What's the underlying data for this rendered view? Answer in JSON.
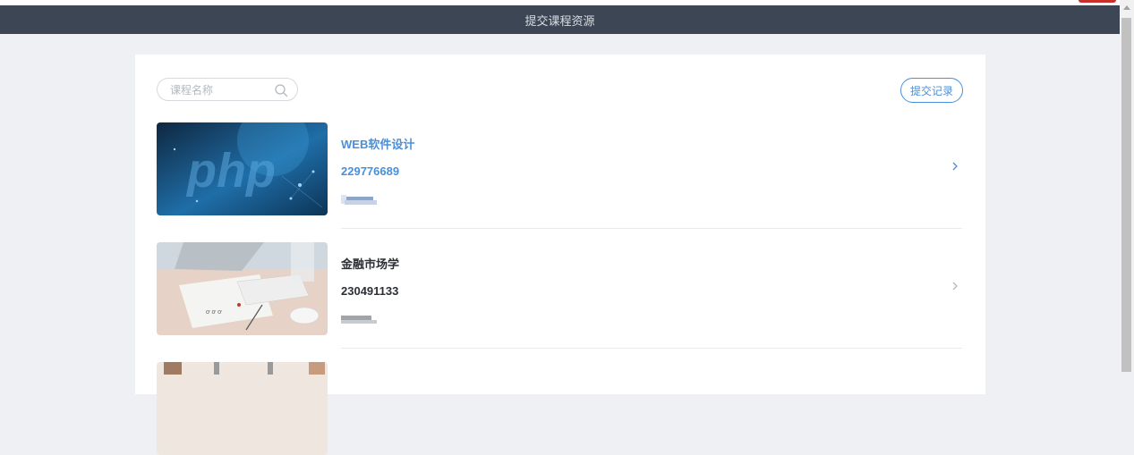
{
  "header": {
    "title": "提交课程资源"
  },
  "search": {
    "placeholder": "课程名称"
  },
  "record_button": {
    "label": "提交记录"
  },
  "courses": [
    {
      "name": "WEB软件设计",
      "code": "229776689",
      "thumbnail": "php-banner",
      "active": true
    },
    {
      "name": "金融市场学",
      "code": "230491133",
      "thumbnail": "desk-keyboard-photo",
      "active": false
    }
  ],
  "colors": {
    "titlebar": "#3c4654",
    "accent": "#4a90d9",
    "background": "#eef0f4"
  },
  "icons": {
    "search": "search-icon",
    "row_arrow": "chevron-right-icon"
  }
}
